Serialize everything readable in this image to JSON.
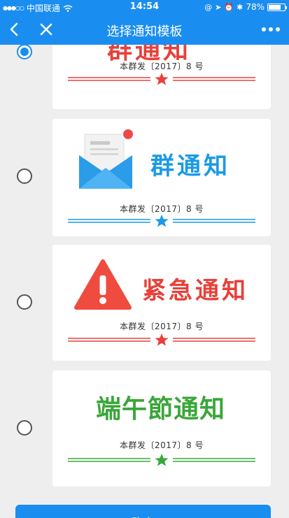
{
  "status_bar": {
    "carrier": "中国联通",
    "time": "14:54",
    "battery_percent": "78%",
    "battery_level": 0.78
  },
  "nav": {
    "title": "选择通知模板",
    "back_icon": "chevron-left-icon",
    "close_icon": "close-icon",
    "more_icon": "more-dots-icon"
  },
  "templates": [
    {
      "title": "群通知",
      "doc_number": "本群发〔2017〕8 号",
      "accent": "#e8403a",
      "selected": true
    },
    {
      "title": "群通知",
      "doc_number": "本群发〔2017〕8 号",
      "accent": "#1a9ae6",
      "selected": false,
      "icon": "envelope-icon"
    },
    {
      "title": "紧急通知",
      "doc_number": "本群发〔2017〕8 号",
      "accent": "#e8403a",
      "selected": false,
      "icon": "warning-icon"
    },
    {
      "title": "端午節通知",
      "doc_number": "本群发〔2017〕8 号",
      "accent": "#3aa63a",
      "selected": false
    }
  ],
  "confirm_label": "确定"
}
